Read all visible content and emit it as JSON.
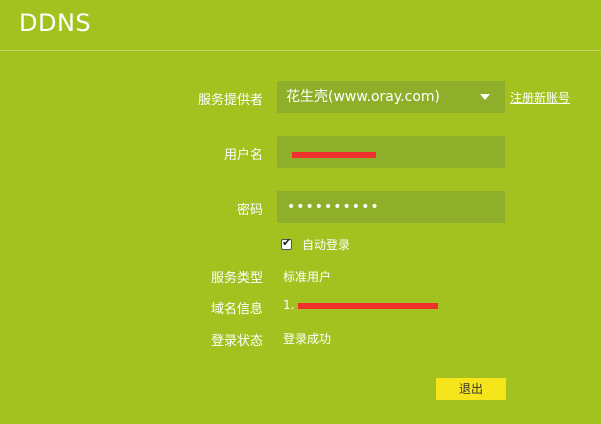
{
  "page": {
    "title": "DDNS"
  },
  "provider": {
    "label": "服务提供者",
    "selected": "花生壳(www.oray.com)",
    "register_link": "注册新账号"
  },
  "username": {
    "label": "用户名"
  },
  "password": {
    "label": "密码",
    "masked": "••••••••••"
  },
  "auto_login": {
    "label": "自动登录",
    "checked": true
  },
  "service_type": {
    "label": "服务类型",
    "value": "标准用户"
  },
  "domain_info": {
    "label": "域名信息",
    "value_prefix": "1."
  },
  "login_status": {
    "label": "登录状态",
    "value": "登录成功"
  },
  "logout_button": {
    "label": "退出"
  },
  "colors": {
    "background": "#a3c220",
    "field": "#8faf2a",
    "button": "#f7e51c",
    "redaction": "#f0302f"
  }
}
